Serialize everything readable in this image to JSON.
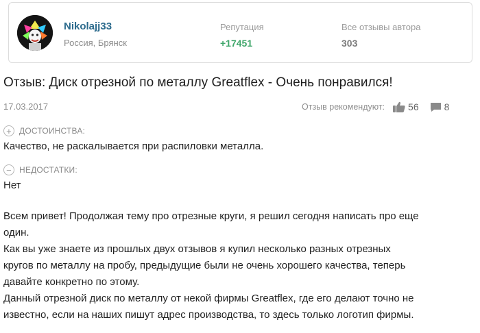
{
  "author": {
    "name": "Nikolajj33",
    "location": "Россия, Брянск",
    "reputation_label": "Репутация",
    "reputation_value": "+17451",
    "reviews_label": "Все отзывы автора",
    "reviews_value": "303"
  },
  "review": {
    "title": "Отзыв: Диск отрезной по металлу Greatflex - Очень понравился!",
    "date": "17.03.2017",
    "recommend_label": "Отзыв рекомендуют:",
    "likes": "56",
    "comments": "8"
  },
  "pros": {
    "heading": "ДОСТОИНСТВА:",
    "text": "Качество, не раскалывается при распиловки металла."
  },
  "cons": {
    "heading": "НЕДОСТАТКИ:",
    "text": "Нет"
  },
  "body": {
    "lines": [
      "Всем привет! Продолжая тему про отрезные круги, я решил сегодня написать про еще",
      "один.",
      "Как вы уже знаете из прошлых двух отзывов я купил несколько разных отрезных",
      "кругов по металлу на пробу, предыдущие были не очень хорошего качества, теперь",
      "давайте конкретно по этому.",
      "Данный отрезной диск по металлу от некой фирмы Greatflex, где его делают точно не",
      "известно, если на наших пишут адрес производства, то здесь только логотип фирмы."
    ]
  },
  "icons": {
    "avatar": "avatar-image",
    "like": "thumbs-up-icon",
    "comment": "comment-icon",
    "pros": "plus-circle-icon",
    "cons": "minus-circle-icon"
  },
  "colors": {
    "author_name": "#2b6a8c",
    "reputation": "#3fa66a",
    "muted": "#8f8f8f"
  }
}
